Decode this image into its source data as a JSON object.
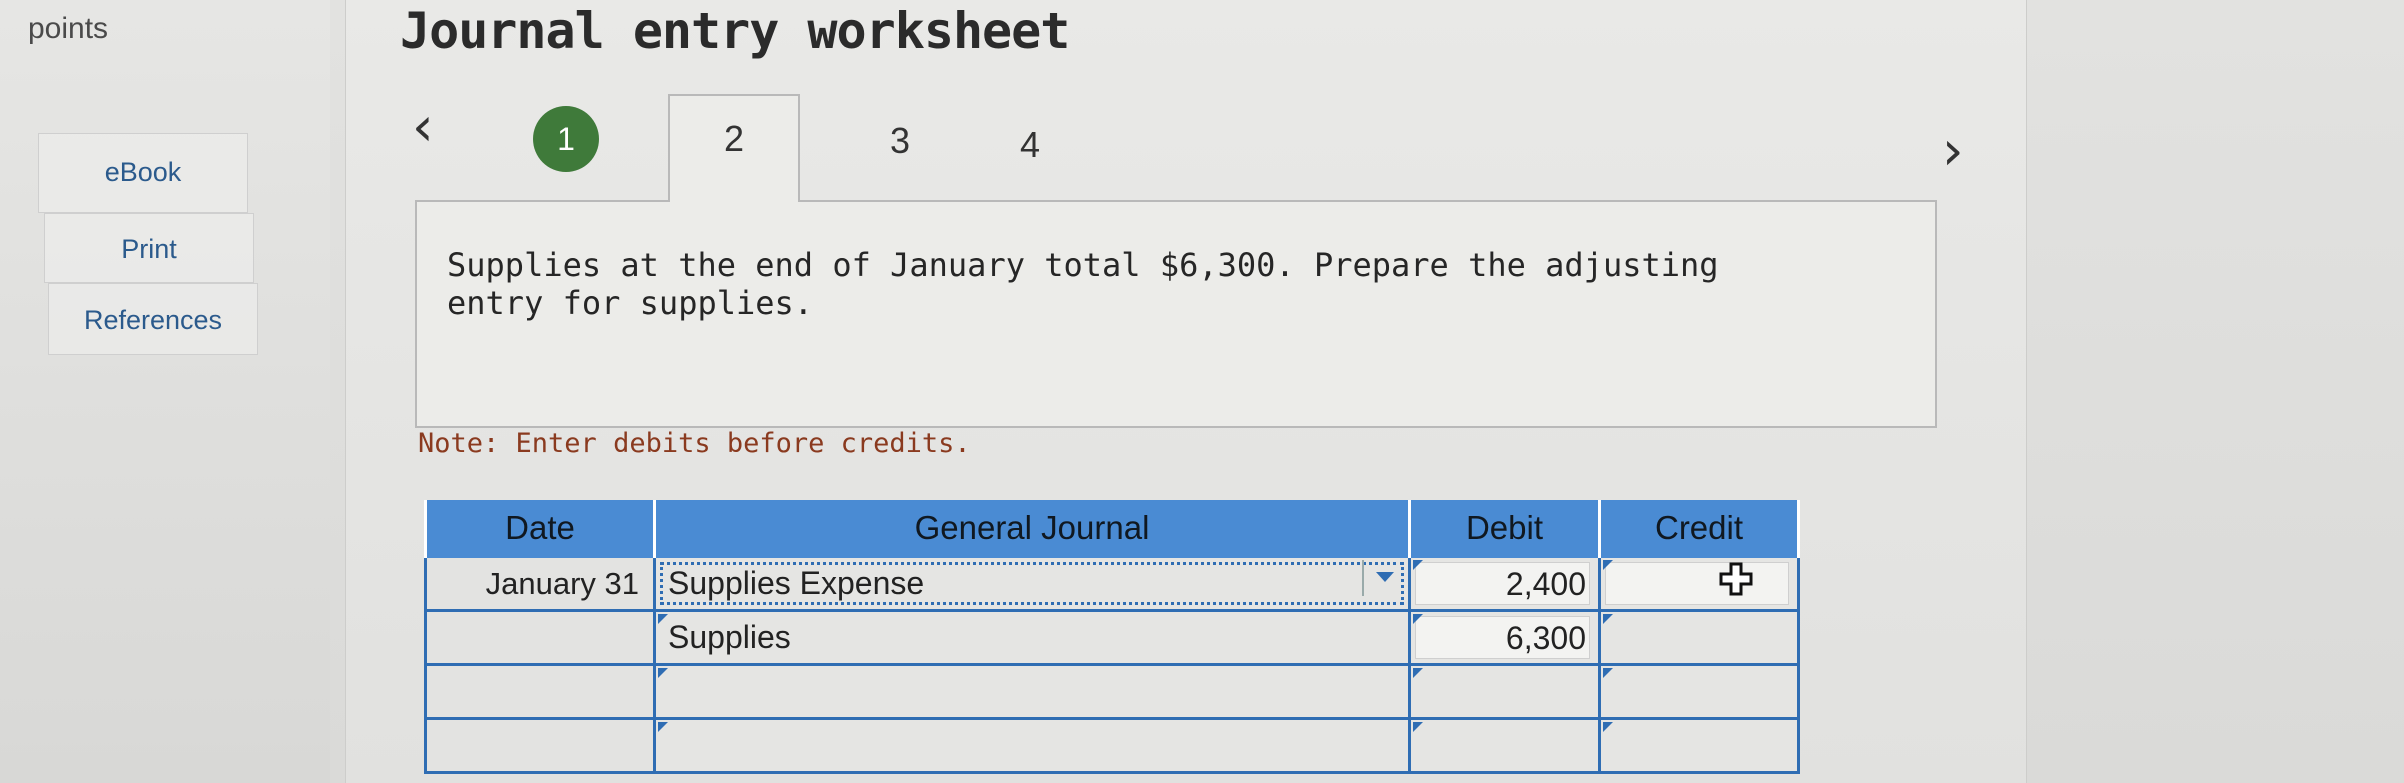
{
  "sidebar": {
    "points_label": "points",
    "ebook_label": "eBook",
    "print_label": "Print",
    "references_label": "References"
  },
  "header": {
    "title": "Journal entry worksheet"
  },
  "steps": {
    "prev_icon": "chevron-left-icon",
    "next_icon": "chevron-right-icon",
    "items": [
      "1",
      "2",
      "3",
      "4"
    ],
    "completed_step": "1",
    "active_step": "2",
    "completed_color": "#3f7a3a"
  },
  "question": {
    "text": "Supplies at the end of January total $6,300. Prepare the adjusting entry for supplies."
  },
  "note": {
    "text": "Note: Enter debits before credits."
  },
  "journal": {
    "header_color": "#4a8bd3",
    "columns": [
      "Date",
      "General Journal",
      "Debit",
      "Credit"
    ],
    "rows": [
      {
        "date": "January 31",
        "account": "Supplies Expense",
        "debit": "2,400",
        "credit": ""
      },
      {
        "date": "",
        "account": "Supplies",
        "debit": "6,300",
        "credit": ""
      },
      {
        "date": "",
        "account": "",
        "debit": "",
        "credit": ""
      },
      {
        "date": "",
        "account": "",
        "debit": "",
        "credit": ""
      }
    ]
  }
}
